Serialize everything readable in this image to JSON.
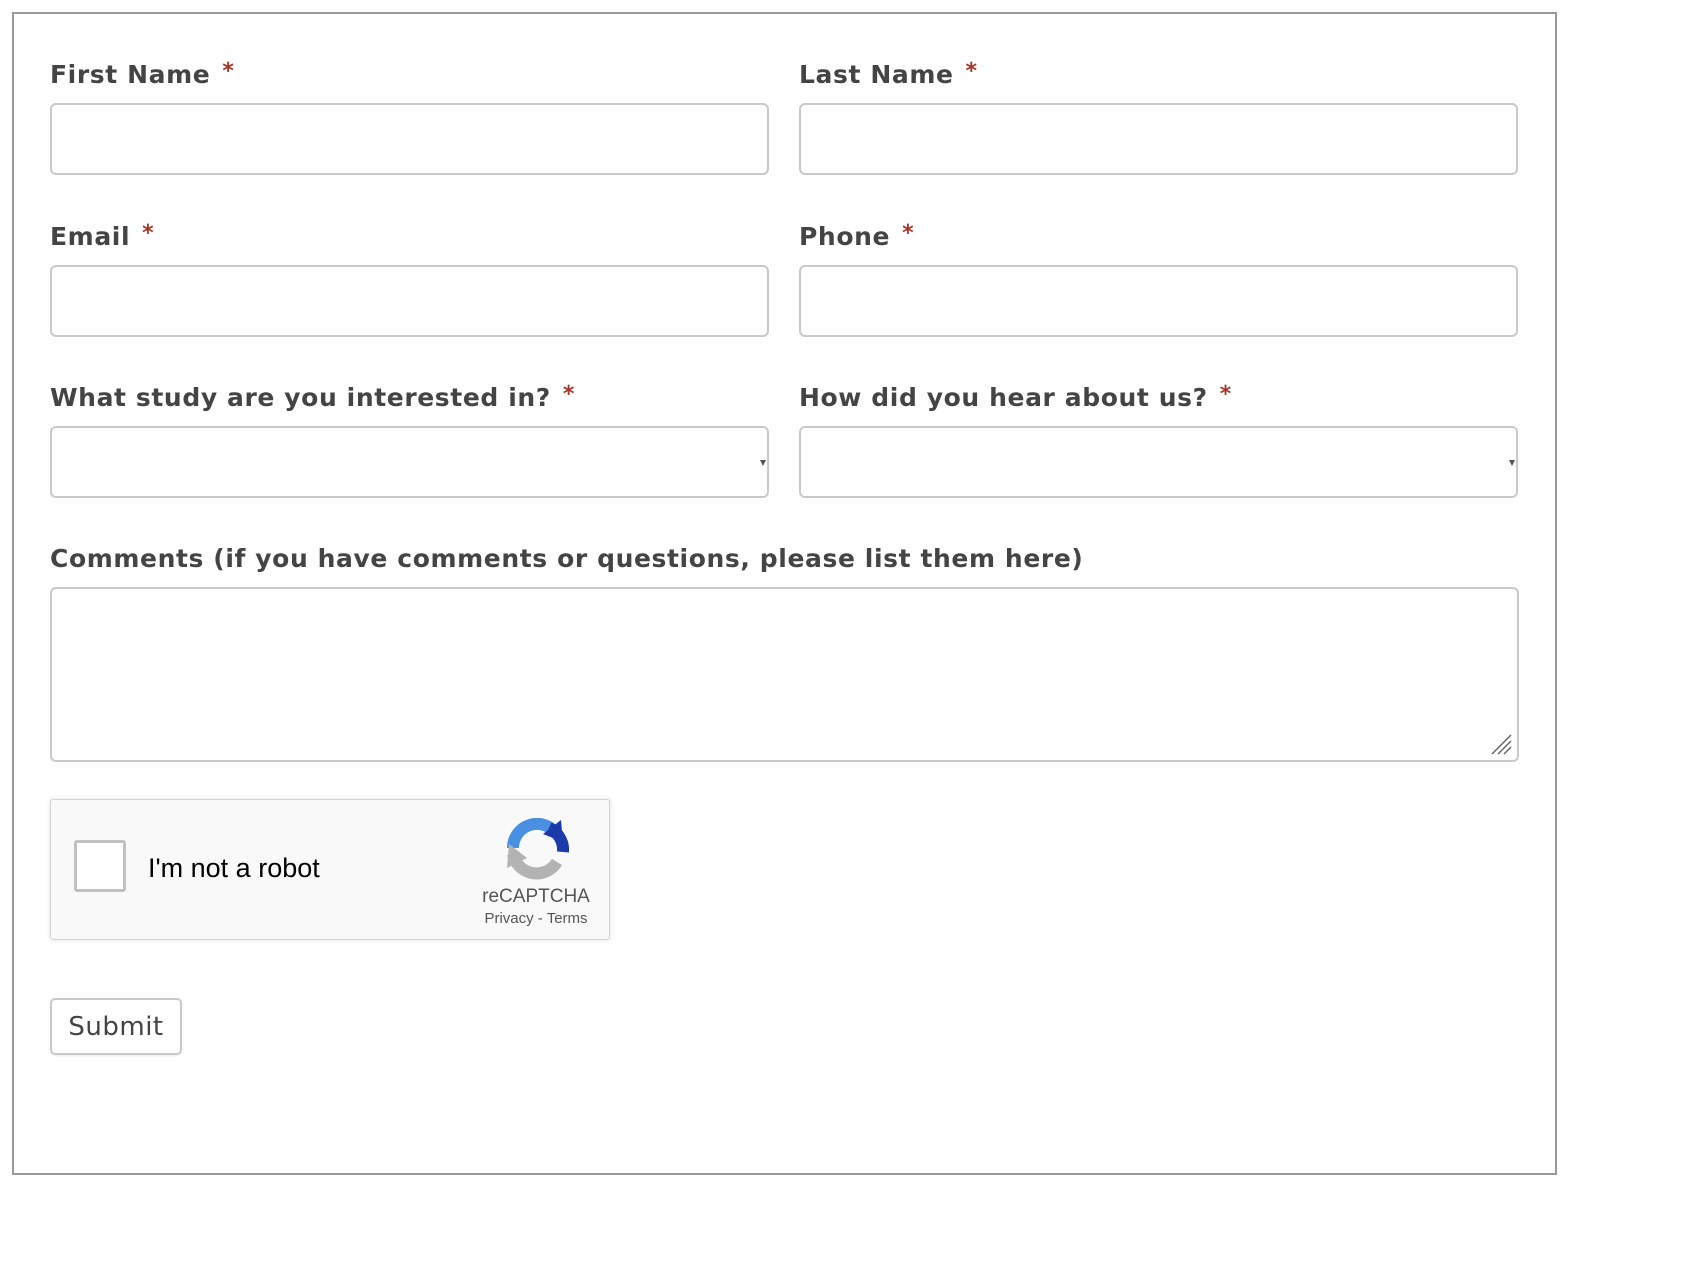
{
  "form": {
    "first_name": {
      "label": "First Name",
      "required_mark": "*",
      "value": ""
    },
    "last_name": {
      "label": "Last Name",
      "required_mark": "*",
      "value": ""
    },
    "email": {
      "label": "Email",
      "required_mark": "*",
      "value": ""
    },
    "phone": {
      "label": "Phone",
      "required_mark": "*",
      "value": ""
    },
    "study": {
      "label": "What study are you interested in?",
      "required_mark": "*",
      "selected": ""
    },
    "heard_about": {
      "label": "How did you hear about us?",
      "required_mark": "*",
      "selected": ""
    },
    "comments": {
      "label": "Comments (if you have comments or questions, please list them here)",
      "value": ""
    },
    "submit_label": "Submit"
  },
  "recaptcha": {
    "checkbox_label": "I'm not a robot",
    "checked": false,
    "brand": "reCAPTCHA",
    "privacy_link": "Privacy",
    "separator": "-",
    "terms_link": "Terms",
    "icon": "recaptcha-logo-icon"
  },
  "colors": {
    "label_text": "#444444",
    "required_mark": "#a8342a",
    "field_border": "#c9c9c9",
    "frame_border": "#9a9a9a",
    "recaptcha_blue": "#4a90e2",
    "recaptcha_dark_blue": "#1c3aa9",
    "recaptcha_grey": "#b3b3b3"
  }
}
